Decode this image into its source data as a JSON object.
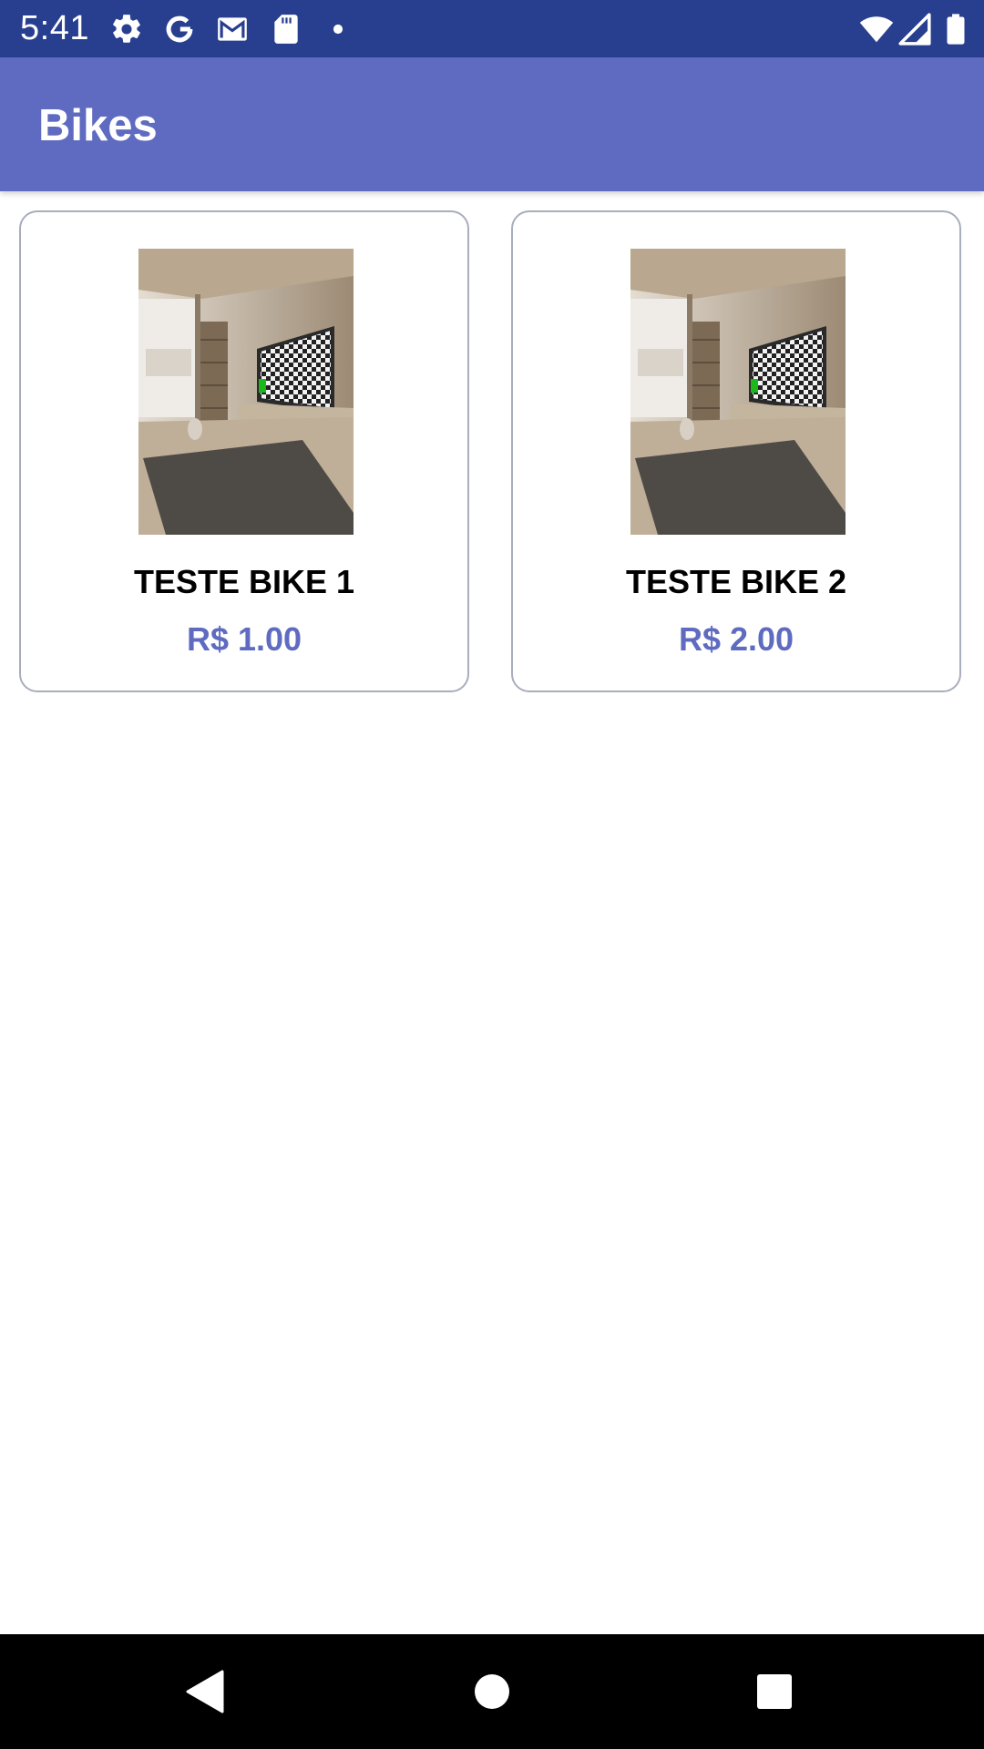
{
  "status_bar": {
    "time": "5:41",
    "left_icons": [
      "gear-icon",
      "google-icon",
      "gmail-icon",
      "sd-card-icon",
      "dot-icon"
    ],
    "right_icons": [
      "wifi-icon",
      "signal-icon",
      "battery-icon"
    ]
  },
  "app_bar": {
    "title": "Bikes"
  },
  "colors": {
    "status_bar": "#283f8f",
    "app_bar": "#5f6bc0",
    "price": "#5f6bc0",
    "card_border": "#a9adbc",
    "nav_bar": "#000000"
  },
  "products": [
    {
      "name": "TESTE BIKE 1",
      "price": "R$ 1.00",
      "image": "room-with-tv-thumbnail"
    },
    {
      "name": "TESTE BIKE 2",
      "price": "R$ 2.00",
      "image": "room-with-tv-thumbnail"
    }
  ],
  "nav_bar": {
    "buttons": [
      "back-icon",
      "home-icon",
      "recents-icon"
    ]
  }
}
